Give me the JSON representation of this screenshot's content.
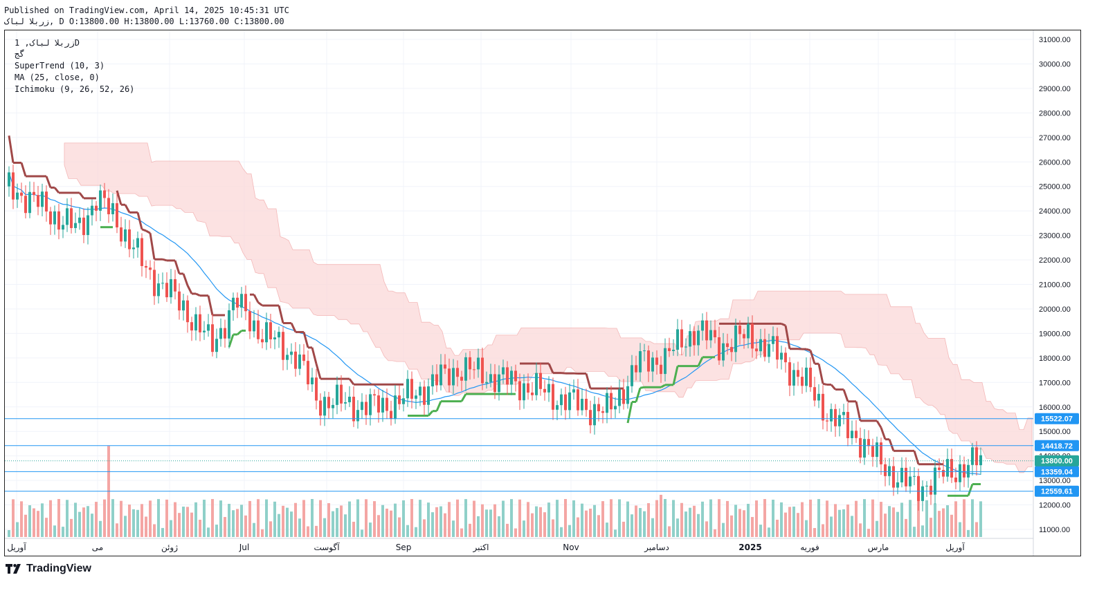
{
  "header": {
    "published": "Published on TradingView.com, April 14, 2025 10:45:31 UTC",
    "ohlc": "زربلا لباک, D O:13800.00 H:13800.00 L:13760.00 C:13800.00"
  },
  "legend": {
    "symbol": "زربلا لباک, 1D",
    "sub": "گج",
    "supertrend": "SuperTrend (10, 3)",
    "ma": "MA (25, close, 0)",
    "ichimoku": "Ichimoku (9, 26, 52, 26)"
  },
  "footer": {
    "brand": "TradingView"
  },
  "colors": {
    "up": "#26a69a",
    "down": "#ef5350",
    "up_vol": "#8fd0c9",
    "down_vol": "#f4a6a4",
    "supertrend_up": "#4caf50",
    "supertrend_down": "#a04848",
    "ma": "#2196f3",
    "cloud_bear": "#fbd9d9",
    "cloud_bull": "#d6ecd6",
    "hline": "#2196f3",
    "last": "#26a69a"
  },
  "chart_data": {
    "type": "candlestick",
    "y_axis_ticks": [
      "31000.00",
      "30000.00",
      "29000.00",
      "28000.00",
      "27000.00",
      "26000.00",
      "25000.00",
      "24000.00",
      "23000.00",
      "22000.00",
      "21000.00",
      "20000.00",
      "19000.00",
      "18000.00",
      "17000.00",
      "16000.00",
      "15000.00",
      "14000.00",
      "13000.00",
      "12000.00",
      "11000.00"
    ],
    "ylim": [
      10700,
      31400
    ],
    "x_axis_labels": [
      "آوریل",
      "می",
      "ژوئن",
      "Jul",
      "آگوست",
      "Sep",
      "اکتبر",
      "Nov",
      "دسامبر",
      "2025",
      "فوریه",
      "مارس",
      "آوریل"
    ],
    "horizontal_levels": [
      {
        "value": 15522.07,
        "label": "15522.07"
      },
      {
        "value": 14418.72,
        "label": "14418.72"
      },
      {
        "value": 13359.04,
        "label": "13359.04"
      },
      {
        "value": 12559.61,
        "label": "12559.61"
      }
    ],
    "last_price": {
      "value": 13800.0,
      "label": "13800.00"
    },
    "close_series": [
      {
        "date": "2024-04-10",
        "close": 25000
      },
      {
        "date": "2024-04-25",
        "close": 24000
      },
      {
        "date": "2024-05-06",
        "close": 23200
      },
      {
        "date": "2024-05-13",
        "close": 24500
      },
      {
        "date": "2024-05-20",
        "close": 23800
      },
      {
        "date": "2024-06-01",
        "close": 21600
      },
      {
        "date": "2024-06-16",
        "close": 20000
      },
      {
        "date": "2024-06-26",
        "close": 18500
      },
      {
        "date": "2024-07-05",
        "close": 20300
      },
      {
        "date": "2024-07-15",
        "close": 19000
      },
      {
        "date": "2024-07-28",
        "close": 18100
      },
      {
        "date": "2024-08-05",
        "close": 16300
      },
      {
        "date": "2024-08-25",
        "close": 16000
      },
      {
        "date": "2024-09-05",
        "close": 16200
      },
      {
        "date": "2024-09-28",
        "close": 17600
      },
      {
        "date": "2024-10-05",
        "close": 17400
      },
      {
        "date": "2024-10-25",
        "close": 16800
      },
      {
        "date": "2024-11-04",
        "close": 16400
      },
      {
        "date": "2024-11-15",
        "close": 16000
      },
      {
        "date": "2024-11-24",
        "close": 15800
      },
      {
        "date": "2024-12-05",
        "close": 17800
      },
      {
        "date": "2024-12-15",
        "close": 18000
      },
      {
        "date": "2024-12-27",
        "close": 19200
      },
      {
        "date": "2025-01-04",
        "close": 18500
      },
      {
        "date": "2025-01-16",
        "close": 18900
      },
      {
        "date": "2025-01-26",
        "close": 18200
      },
      {
        "date": "2025-02-06",
        "close": 17000
      },
      {
        "date": "2025-02-16",
        "close": 15600
      },
      {
        "date": "2025-02-26",
        "close": 14800
      },
      {
        "date": "2025-03-06",
        "close": 13800
      },
      {
        "date": "2025-03-16",
        "close": 12900
      },
      {
        "date": "2025-03-21",
        "close": 12700
      },
      {
        "date": "2025-04-01",
        "close": 13300
      },
      {
        "date": "2025-04-14",
        "close": 13800
      }
    ],
    "grid": true
  }
}
